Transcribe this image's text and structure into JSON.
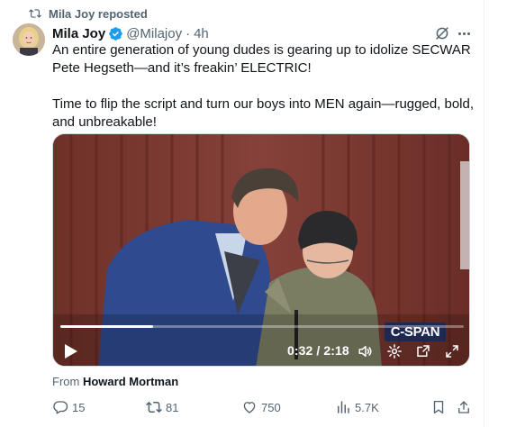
{
  "repost": {
    "text": "Mila Joy reposted"
  },
  "author": {
    "name": "Mila Joy",
    "handle": "@Milajoy",
    "separator": "·",
    "time": "4h"
  },
  "tweet": {
    "paragraph1": "An entire generation of young dudes is gearing up to idolize SECWAR Pete Hegseth—and it’s freakin’ ELECTRIC!",
    "paragraph2": "Time to flip the script and turn our boys into MEN again—rugged, bold, and unbreakable!"
  },
  "video": {
    "time": "0:32 / 2:18",
    "progress_fraction": 0.23,
    "watermark": "C-SPAN"
  },
  "source": {
    "prefix": "From",
    "name": "Howard Mortman"
  },
  "actions": {
    "replies": "15",
    "reposts": "81",
    "likes": "750",
    "views": "5.7K"
  },
  "colors": {
    "verified": "#1d9bf0",
    "text_secondary": "#536471",
    "repost_green": "#536471"
  }
}
